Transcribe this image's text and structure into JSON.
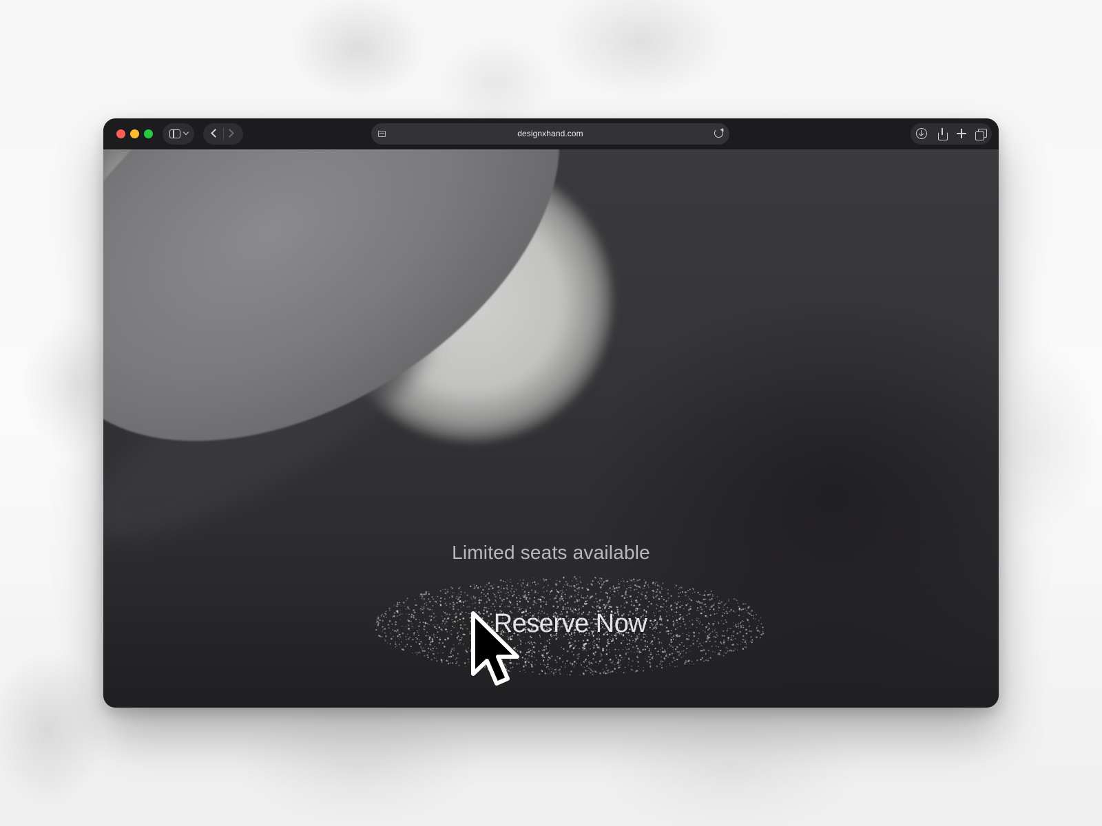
{
  "browser": {
    "url": "designxhand.com",
    "icons": {
      "sidebar": "sidebar-toggle-icon",
      "back": "chevron-left-icon",
      "forward": "chevron-right-icon",
      "page": "page-menu-icon",
      "reload": "reload-icon",
      "download": "download-icon",
      "share": "share-icon",
      "new_tab": "plus-icon",
      "tabs": "tab-overview-icon"
    },
    "traffic_colors": {
      "close": "#fe5f57",
      "minimize": "#febc2e",
      "maximize": "#28c840"
    }
  },
  "hero": {
    "tagline": "Limited seats available",
    "cta_label": "Reserve Now"
  },
  "pointer": {
    "icon": "mouse-pointer-icon"
  }
}
